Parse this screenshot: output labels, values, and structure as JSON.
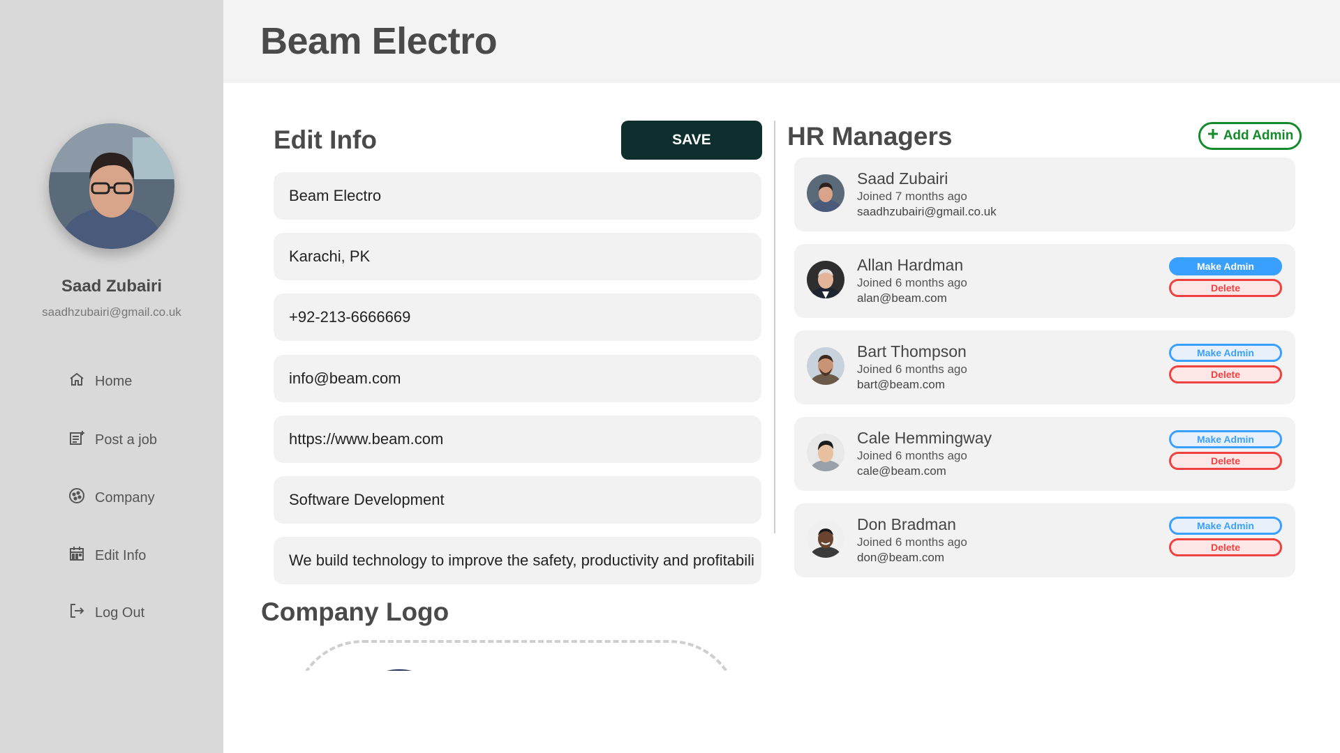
{
  "sidebar": {
    "user_name": "Saad Zubairi",
    "user_email": "saadhzubairi@gmail.co.uk",
    "nav": [
      {
        "label": "Home",
        "icon": "home-icon"
      },
      {
        "label": "Post a job",
        "icon": "post-job-icon"
      },
      {
        "label": "Company",
        "icon": "company-icon"
      },
      {
        "label": "Edit Info",
        "icon": "calendar-icon"
      },
      {
        "label": "Log Out",
        "icon": "logout-icon"
      }
    ]
  },
  "header": {
    "title": "Beam Electro"
  },
  "edit_info": {
    "title": "Edit Info",
    "save_label": "SAVE",
    "fields": [
      "Beam Electro",
      "Karachi, PK",
      "+92-213-6666669",
      "info@beam.com",
      "https://www.beam.com",
      "Software Development",
      "We build technology to improve the safety, productivity and profitabili"
    ]
  },
  "company_logo": {
    "title": "Company Logo"
  },
  "hr_managers": {
    "title": "HR Managers",
    "add_admin_label": "Add Admin",
    "make_admin_label": "Make Admin",
    "delete_label": "Delete",
    "managers": [
      {
        "name": "Saad Zubairi",
        "joined": "Joined 7 months ago",
        "email": "saadhzubairi@gmail.co.uk"
      },
      {
        "name": "Allan Hardman",
        "joined": "Joined 6 months ago",
        "email": "alan@beam.com"
      },
      {
        "name": "Bart Thompson",
        "joined": "Joined 6 months ago",
        "email": "bart@beam.com"
      },
      {
        "name": "Cale Hemmingway",
        "joined": "Joined 6 months ago",
        "email": "cale@beam.com"
      },
      {
        "name": "Don Bradman",
        "joined": "Joined 6 months ago",
        "email": "don@beam.com"
      }
    ]
  },
  "colors": {
    "sidebar_bg": "#d9d9d9",
    "save_button": "#0d2f2d",
    "add_admin": "#148a2a",
    "make_admin": "#3aa0ff",
    "delete": "#f04040"
  }
}
